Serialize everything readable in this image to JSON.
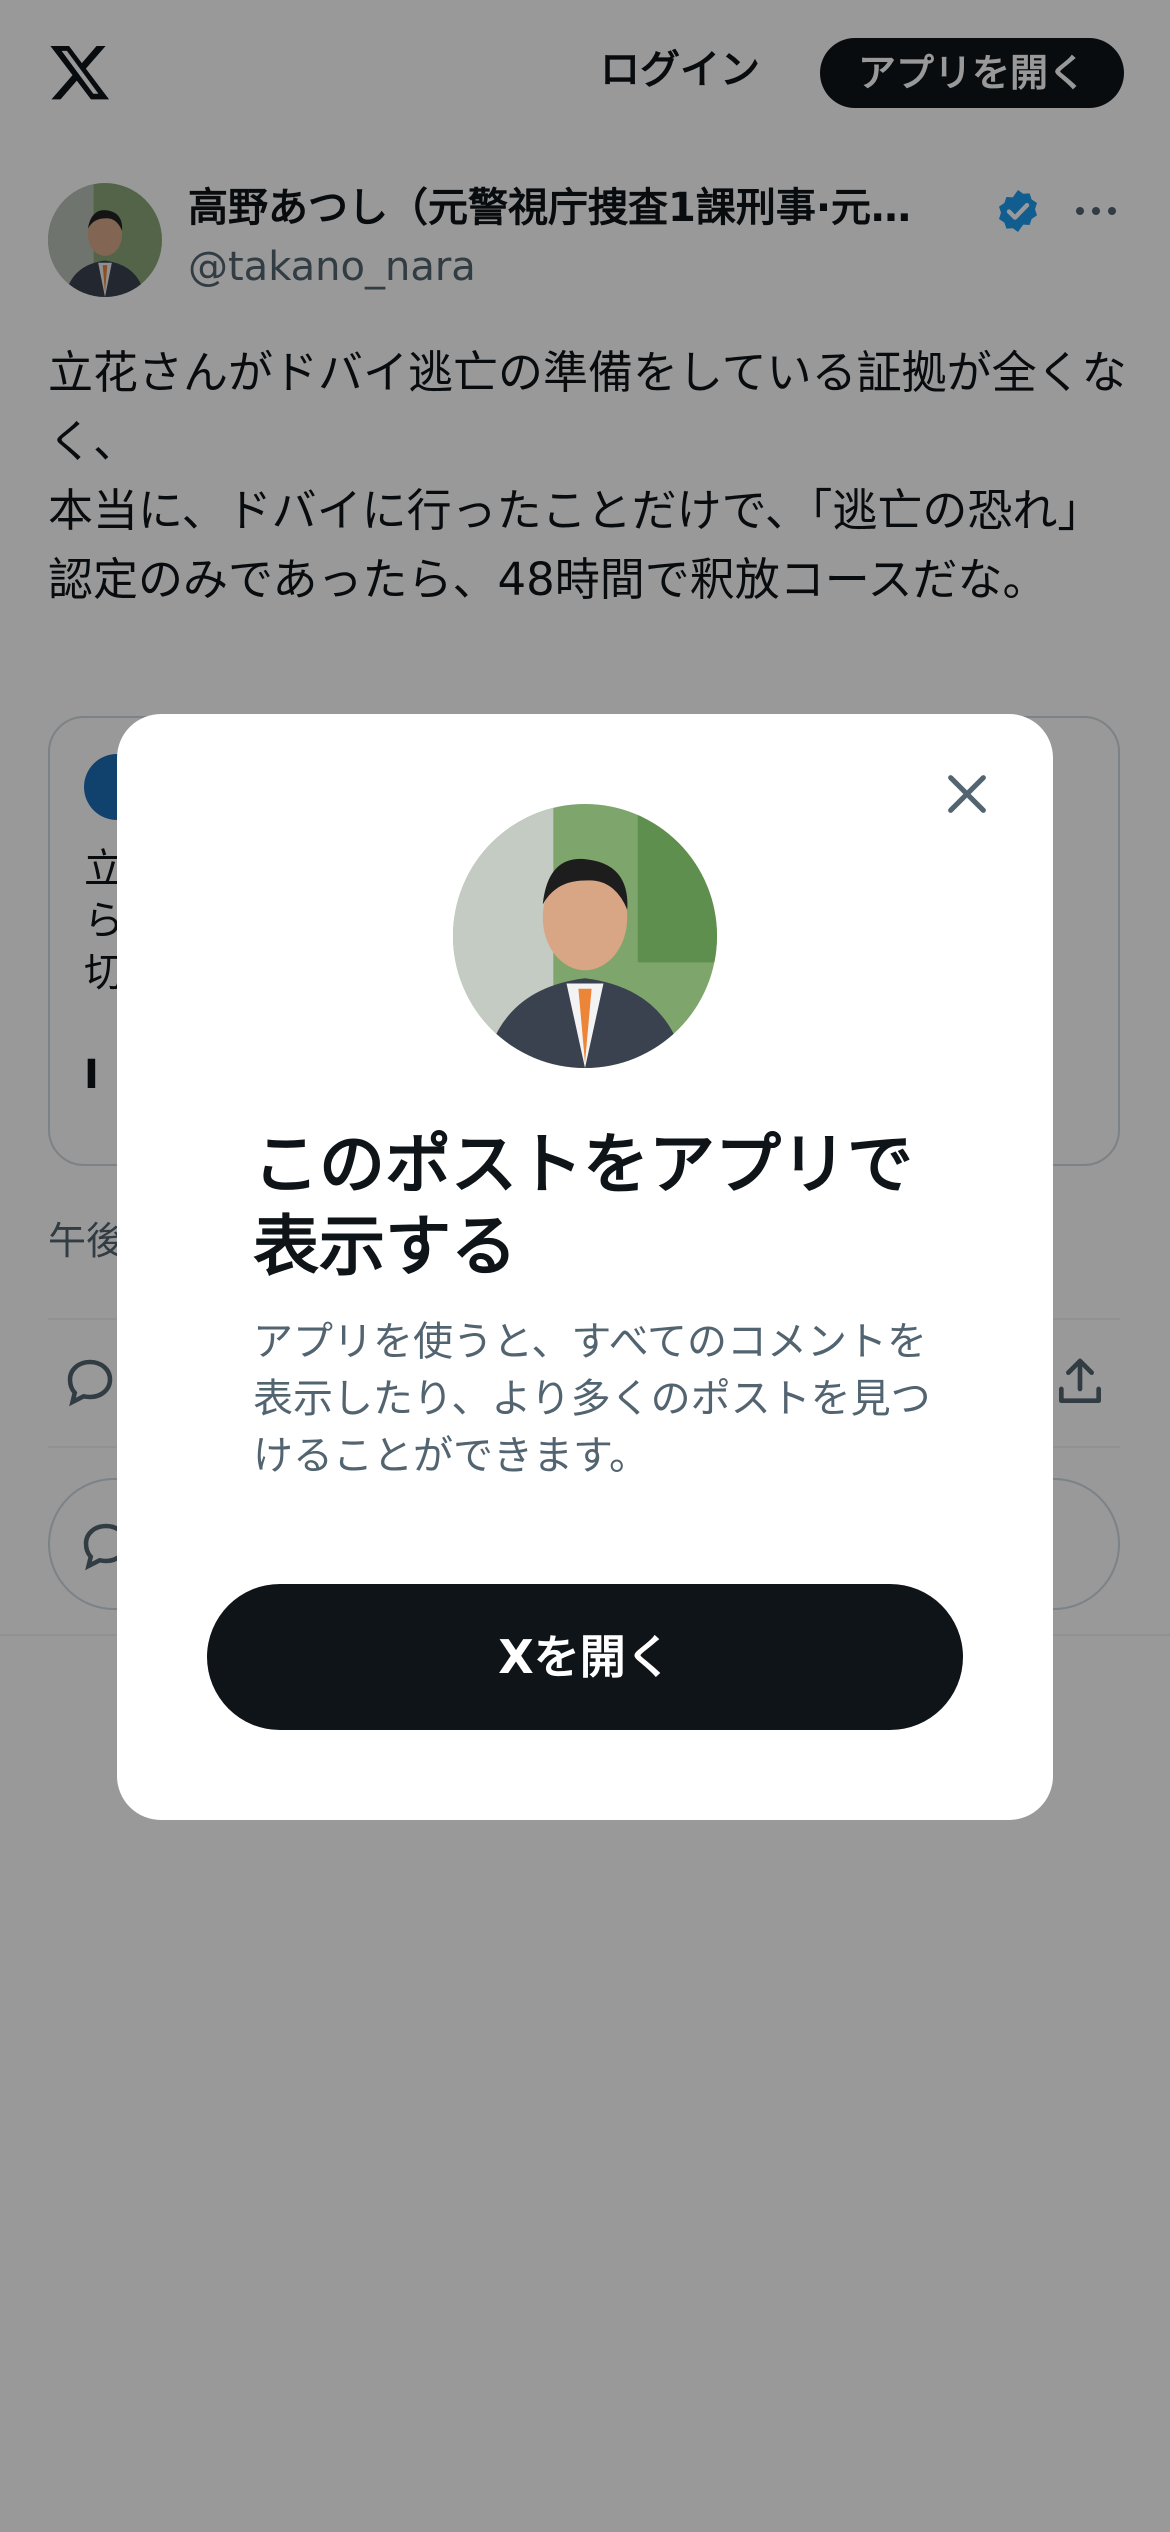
{
  "header": {
    "logo_icon": "x-logo-icon",
    "login_label": "ログイン",
    "open_app_label": "アプリを開く"
  },
  "author": {
    "name": "高野あつし（元警視庁捜査1課刑事·元…",
    "handle": "@takano_nara",
    "verified_icon": "verified-badge-icon",
    "more_icon": "more-icon"
  },
  "tweet": {
    "text": "立花さんがドバイ逃亡の準備をしている証拠が全くなく、\n本当に、ドバイに行ったことだけで、「逃亡の恐れ」認定のみであったら、48時間で釈放コースだな。",
    "timestamp": "午後",
    "quote_lines": [
      "立",
      "ら",
      "切"
    ],
    "quote_tail": "I"
  },
  "actions": {
    "reply_icon": "reply-icon",
    "share_icon": "share-icon"
  },
  "modal": {
    "title": "このポストをアプリで表示する",
    "body": "アプリを使うと、すべてのコメントを表示したり、より多くのポストを見つけることができます。",
    "cta_label": "Xを開く",
    "close_icon": "close-icon"
  },
  "colors": {
    "text_primary": "#0f1419",
    "text_secondary": "#536471",
    "verified_blue": "#1d9bf0",
    "button_dark": "#0f1419",
    "overlay": "rgba(0,0,0,0.4)"
  }
}
